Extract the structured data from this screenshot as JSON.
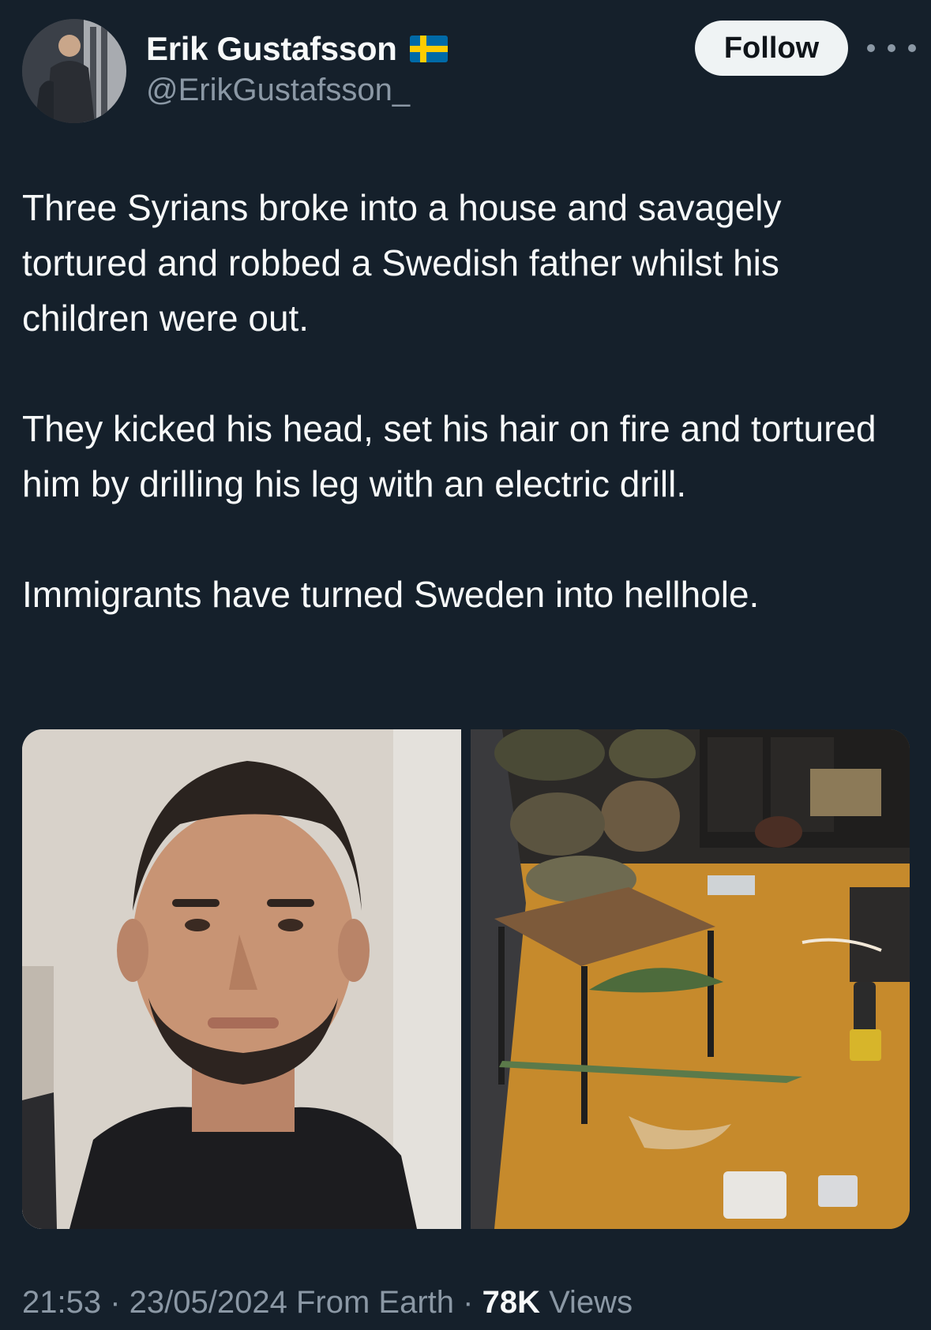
{
  "author": {
    "display_name": "Erik Gustafsson",
    "handle": "@ErikGustafsson_",
    "flag_icon": "swedish-flag-icon",
    "flag_colors": {
      "blue": "#006aa7",
      "yellow": "#fecc00"
    }
  },
  "actions": {
    "follow_label": "Follow",
    "more_icon": "more-options-icon"
  },
  "tweet": {
    "paragraphs": [
      "Three Syrians broke into a house and savagely tortured and robbed a Swedish father whilst his children were out.",
      "They kicked his head, set his hair on fire and tortured him by drilling his leg with an electric drill.",
      "Immigrants have turned Sweden into hellhole."
    ]
  },
  "media": {
    "photos": [
      "portrait-photo",
      "crime-scene-photo"
    ]
  },
  "footer": {
    "time": "21:53",
    "date": "23/05/2024",
    "source": "From Earth",
    "views_count": "78K",
    "views_label": "Views",
    "separator": " · "
  },
  "theme": {
    "background": "#15202b",
    "text_primary": "#f7f9f9",
    "text_secondary": "#8b98a5",
    "button_bg": "#eff3f4"
  }
}
